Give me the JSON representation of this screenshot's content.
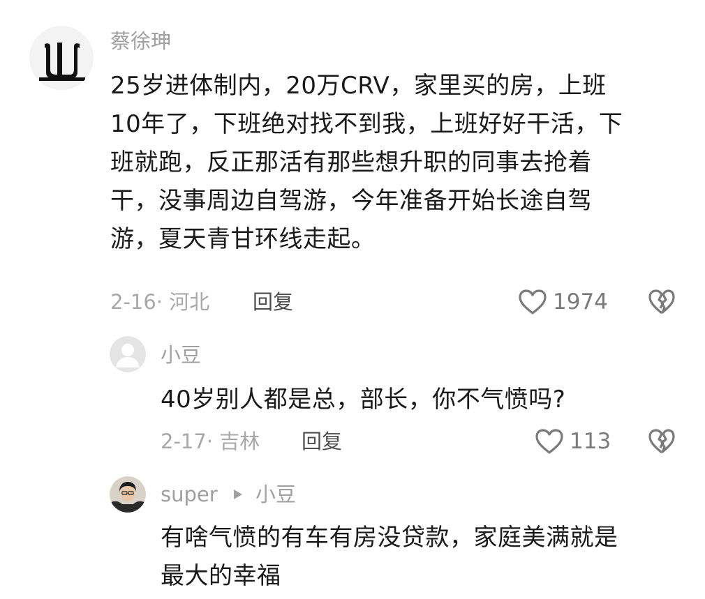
{
  "comment": {
    "author": "蔡徐珅",
    "text_lines": [
      "25岁进体制内，20万CRV，家里买的房，上班",
      "10年了，下班绝对找不到我，上班好好干活，下",
      "班就跑，反正那活有那些想升职的同事去抢着",
      "干，没事周边自驾游，今年准备开始长途自驾",
      "游，夏天青甘环线走起。"
    ],
    "date_location": "2-16· 河北",
    "reply_label": "回复",
    "like_count": "1974"
  },
  "replies": [
    {
      "author": "小豆",
      "text_lines": [
        "40岁别人都是总，部长，你不气愤吗?"
      ],
      "date_location": "2-17· 吉林",
      "reply_label": "回复",
      "like_count": "113"
    },
    {
      "author": "super",
      "reply_to": "小豆",
      "text_lines": [
        "有啥气愤的有车有房没贷款，家庭美满就是",
        "最大的幸福"
      ]
    }
  ],
  "icons": {
    "like": "heart-outline-icon",
    "dislike": "broken-heart-icon",
    "reply_arrow": "triangle-right-icon"
  },
  "colors": {
    "text": "#1a1a1a",
    "secondary": "#a0a0a0",
    "icon": "#7a7a7a"
  }
}
